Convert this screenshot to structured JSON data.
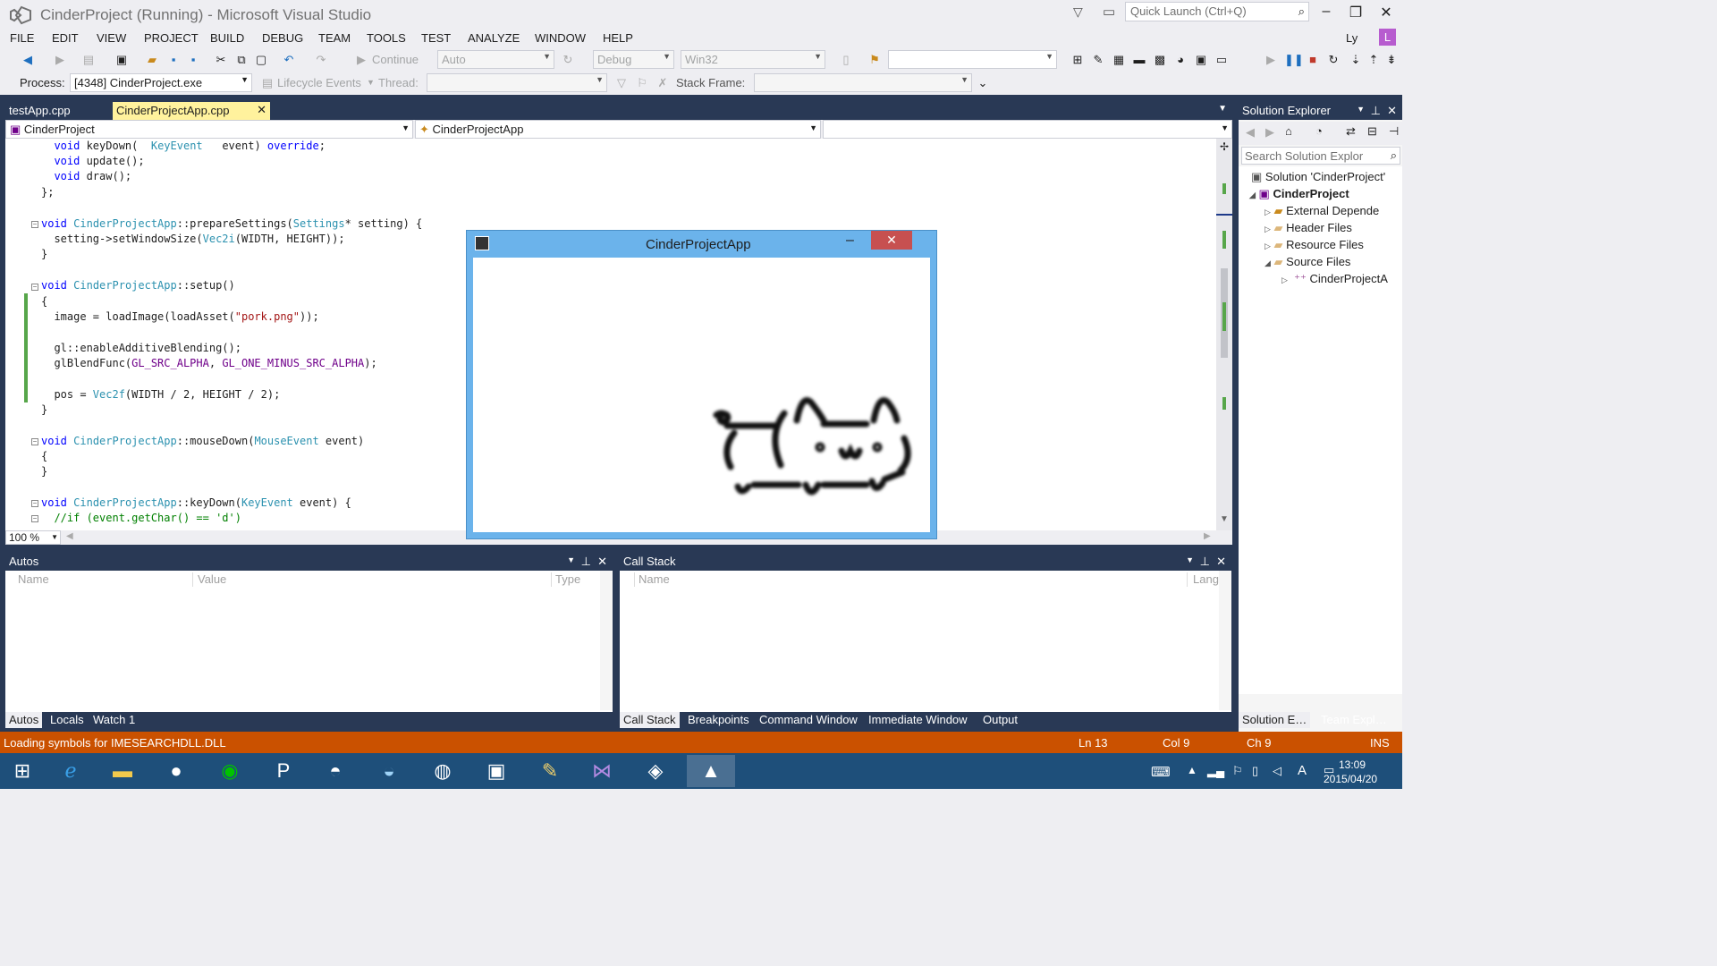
{
  "titlebar": {
    "title": "CinderProject (Running) - Microsoft Visual Studio",
    "quick_launch_placeholder": "Quick Launch (Ctrl+Q)",
    "user_name": "Ly",
    "user_initial": "L"
  },
  "menu": [
    "FILE",
    "EDIT",
    "VIEW",
    "PROJECT",
    "BUILD",
    "DEBUG",
    "TEAM",
    "TOOLS",
    "TEST",
    "ANALYZE",
    "WINDOW",
    "HELP"
  ],
  "toolbar": {
    "continue_label": "Continue",
    "platform_auto": "Auto",
    "configuration": "Debug",
    "platform": "Win32"
  },
  "debug_location": {
    "process_label": "Process:",
    "process_value": "[4348] CinderProject.exe",
    "lifecycle_label": "Lifecycle Events",
    "thread_label": "Thread:",
    "stack_frame_label": "Stack Frame:"
  },
  "tabs": [
    {
      "label": "testApp.cpp",
      "active": false
    },
    {
      "label": "CinderProjectApp.cpp",
      "active": true
    }
  ],
  "navbar": {
    "project": "CinderProject",
    "scope": "CinderProjectApp"
  },
  "zoom": "100 %",
  "app_window": {
    "title": "CinderProjectApp"
  },
  "autos": {
    "title": "Autos",
    "columns": [
      "Name",
      "Value",
      "Type"
    ],
    "tabs": [
      "Autos",
      "Locals",
      "Watch 1"
    ]
  },
  "callstack": {
    "title": "Call Stack",
    "columns": [
      "Name",
      "Lang"
    ],
    "tabs": [
      "Call Stack",
      "Breakpoints",
      "Command Window",
      "Immediate Window",
      "Output"
    ]
  },
  "solution_explorer": {
    "title": "Solution Explorer",
    "search_placeholder": "Search Solution Explor",
    "items": [
      {
        "label": "Solution 'CinderProject'",
        "bold": false
      },
      {
        "label": "CinderProject",
        "bold": true
      },
      {
        "label": "External Depende",
        "bold": false
      },
      {
        "label": "Header Files",
        "bold": false
      },
      {
        "label": "Resource Files",
        "bold": false
      },
      {
        "label": "Source Files",
        "bold": false
      },
      {
        "label": "CinderProjectA",
        "bold": false
      }
    ],
    "tabs": [
      "Solution E…",
      "Team Expl…"
    ]
  },
  "statusbar": {
    "message": "Loading symbols for IMESEARCHDLL.DLL",
    "ln": "Ln 13",
    "col": "Col 9",
    "ch": "Ch 9",
    "mode": "INS"
  },
  "taskbar": {
    "time": "13:09",
    "date": "2015/04/20"
  }
}
